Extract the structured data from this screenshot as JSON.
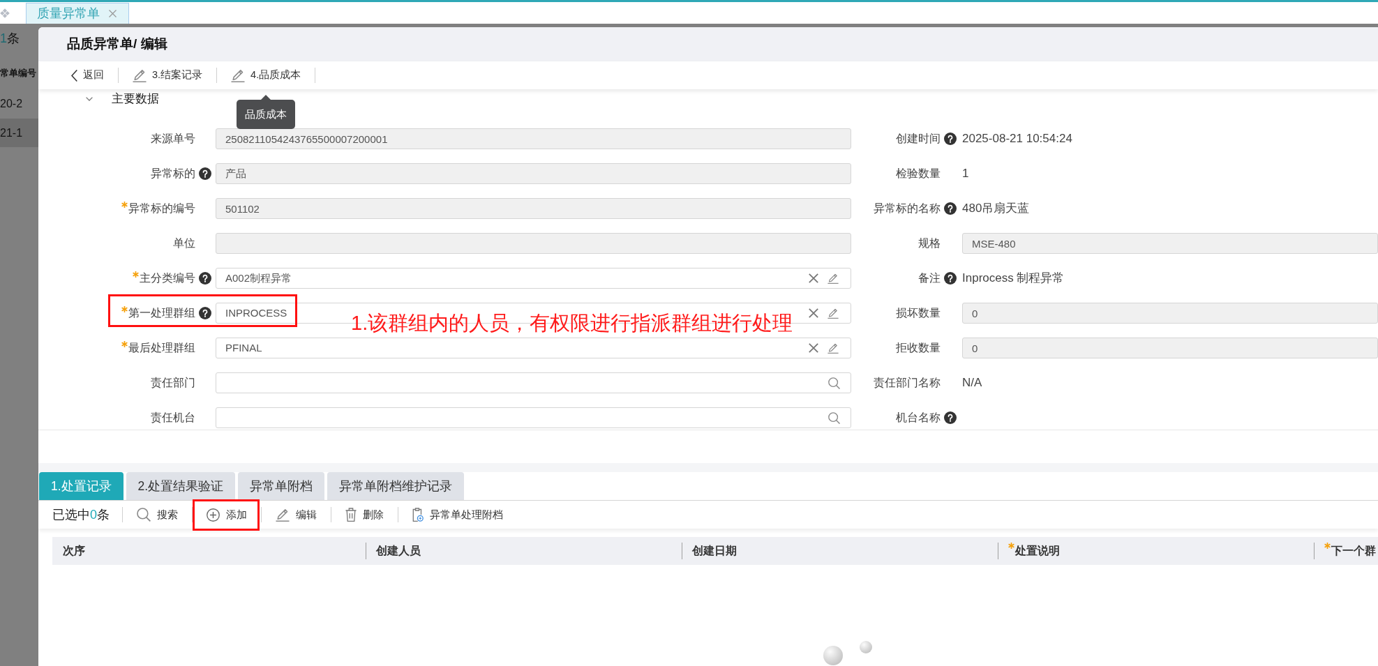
{
  "app_tabs": [
    {
      "label": "质量异常单",
      "selected": true,
      "closable": true
    }
  ],
  "background_list": {
    "count": "1",
    "count_suffix": "条",
    "column": "常单编号",
    "rows": [
      {
        "cell": "20-2",
        "selected": false
      },
      {
        "cell": "21-1",
        "selected": true
      }
    ]
  },
  "dialog": {
    "title": "品质异常单/ 编辑",
    "toolbar": [
      {
        "kind": "back",
        "label": "返回"
      },
      {
        "kind": "edit",
        "label": "3.结案记录"
      },
      {
        "kind": "edit",
        "label": "4.品质成本",
        "tooltip": "品质成本"
      }
    ],
    "section": {
      "title": "主要数据",
      "expanded": true
    },
    "fields_left": [
      {
        "label": "来源单号",
        "required": false,
        "help": false,
        "kind": "readonly",
        "value": "2508211054243765500007200001",
        "highlighted": false
      },
      {
        "label": "异常标的",
        "required": false,
        "help": true,
        "kind": "readonly",
        "value": "产品",
        "highlighted": false
      },
      {
        "label": "异常标的编号",
        "required": true,
        "help": false,
        "kind": "readonly",
        "value": "501102",
        "highlighted": false
      },
      {
        "label": "单位",
        "required": false,
        "help": false,
        "kind": "readonly",
        "highlighted": false
      },
      {
        "label": "主分类编号",
        "required": true,
        "help": true,
        "kind": "lookup",
        "value": "A002制程异常",
        "highlighted": false
      },
      {
        "label": "第一处理群组",
        "required": true,
        "help": true,
        "kind": "lookup",
        "value": "INPROCESS",
        "highlighted": true,
        "callout": "1.该群组内的人员，有权限进行指派群组进行处理"
      },
      {
        "label": "最后处理群组",
        "required": true,
        "help": false,
        "kind": "lookup",
        "value": "PFINAL",
        "highlighted": false
      },
      {
        "label": "责任部门",
        "required": false,
        "help": false,
        "kind": "search",
        "highlighted": false
      },
      {
        "label": "责任机台",
        "required": false,
        "help": false,
        "kind": "search",
        "highlighted": false
      }
    ],
    "fields_right": [
      {
        "label": "创建时间",
        "required": false,
        "help": true,
        "kind": "text",
        "value": "2025-08-21 10:54:24",
        "highlighted": false
      },
      {
        "label": "检验数量",
        "required": false,
        "help": false,
        "kind": "text",
        "value": "1",
        "highlighted": false
      },
      {
        "label": "异常标的名称",
        "required": false,
        "help": true,
        "kind": "text",
        "value": "480吊扇天蓝",
        "highlighted": false
      },
      {
        "label": "规格",
        "required": false,
        "help": false,
        "kind": "readonly",
        "value": "MSE-480",
        "highlighted": false
      },
      {
        "label": "备注",
        "required": false,
        "help": true,
        "kind": "text",
        "value": "Inprocess 制程异常",
        "highlighted": false
      },
      {
        "label": "损坏数量",
        "required": false,
        "help": false,
        "kind": "readonly",
        "value": "0",
        "highlighted": false
      },
      {
        "label": "拒收数量",
        "required": false,
        "help": false,
        "kind": "readonly",
        "value": "0",
        "highlighted": false
      },
      {
        "label": "责任部门名称",
        "required": false,
        "help": false,
        "kind": "text",
        "value": "N/A",
        "highlighted": false
      },
      {
        "label": "机台名称",
        "required": false,
        "help": true,
        "kind": "text",
        "highlighted": false
      }
    ],
    "detail_tabs": [
      {
        "label": "1.处置记录",
        "selected": true
      },
      {
        "label": "2.处置结果验证",
        "selected": false
      },
      {
        "label": "异常单附档",
        "selected": false
      },
      {
        "label": "异常单附档维护记录",
        "selected": false
      }
    ],
    "detail_toolbar": {
      "selection": {
        "prefix": "已选中",
        "count": "0",
        "suffix": "条"
      },
      "buttons": [
        {
          "kind": "search",
          "label": "搜索",
          "highlighted": false
        },
        {
          "kind": "add",
          "label": "添加",
          "highlighted": true
        },
        {
          "kind": "edit",
          "label": "编辑",
          "highlighted": false
        },
        {
          "kind": "delete",
          "label": "删除",
          "highlighted": false
        },
        {
          "kind": "attachment",
          "label": "异常单处理附档",
          "highlighted": false
        }
      ]
    },
    "table": {
      "columns": [
        {
          "label": "次序",
          "required": false
        },
        {
          "label": "创建人员",
          "required": false
        },
        {
          "label": "创建日期",
          "required": false
        },
        {
          "label": "处置说明",
          "required": true
        },
        {
          "label": "下一个群",
          "required": true
        }
      ],
      "loading": true
    }
  }
}
